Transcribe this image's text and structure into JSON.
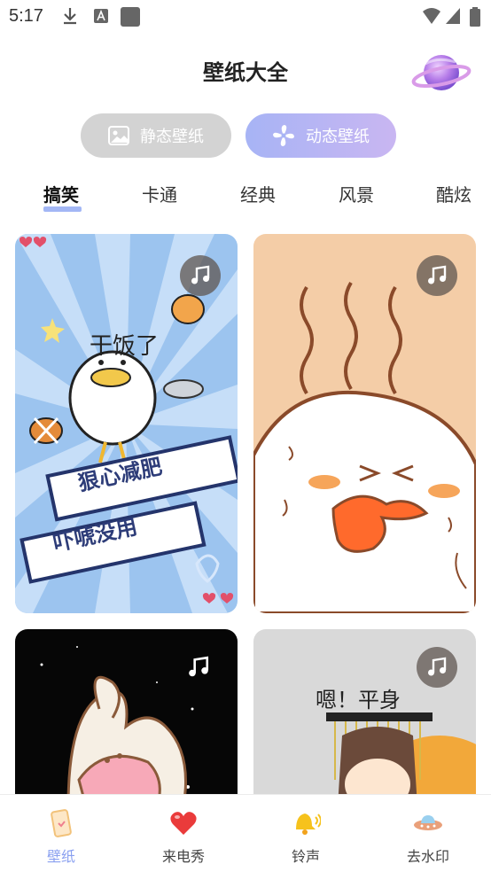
{
  "status_bar": {
    "time": "5:17"
  },
  "header": {
    "title": "壁纸大全"
  },
  "mode_toggle": {
    "static_label": "静态壁纸",
    "dynamic_label": "动态壁纸",
    "selected": "dynamic"
  },
  "categories": [
    "搞笑",
    "卡通",
    "经典",
    "风景",
    "酷炫"
  ],
  "selected_category": "搞笑",
  "cards": [
    {
      "overlay_texts": [
        "干饭了",
        "狠心减肥",
        "吓唬没用"
      ]
    },
    {
      "overlay_texts": []
    },
    {
      "overlay_texts": []
    },
    {
      "overlay_texts": [
        "嗯！平身"
      ]
    }
  ],
  "bottom_nav": {
    "items": [
      "壁纸",
      "来电秀",
      "铃声",
      "去水印"
    ],
    "active": "壁纸"
  },
  "colors": {
    "accent": "#8aa0f0",
    "tab_underline": "#a3b7f5",
    "mode_active_start": "#a7b4f5",
    "mode_active_end": "#c9b6f2"
  }
}
